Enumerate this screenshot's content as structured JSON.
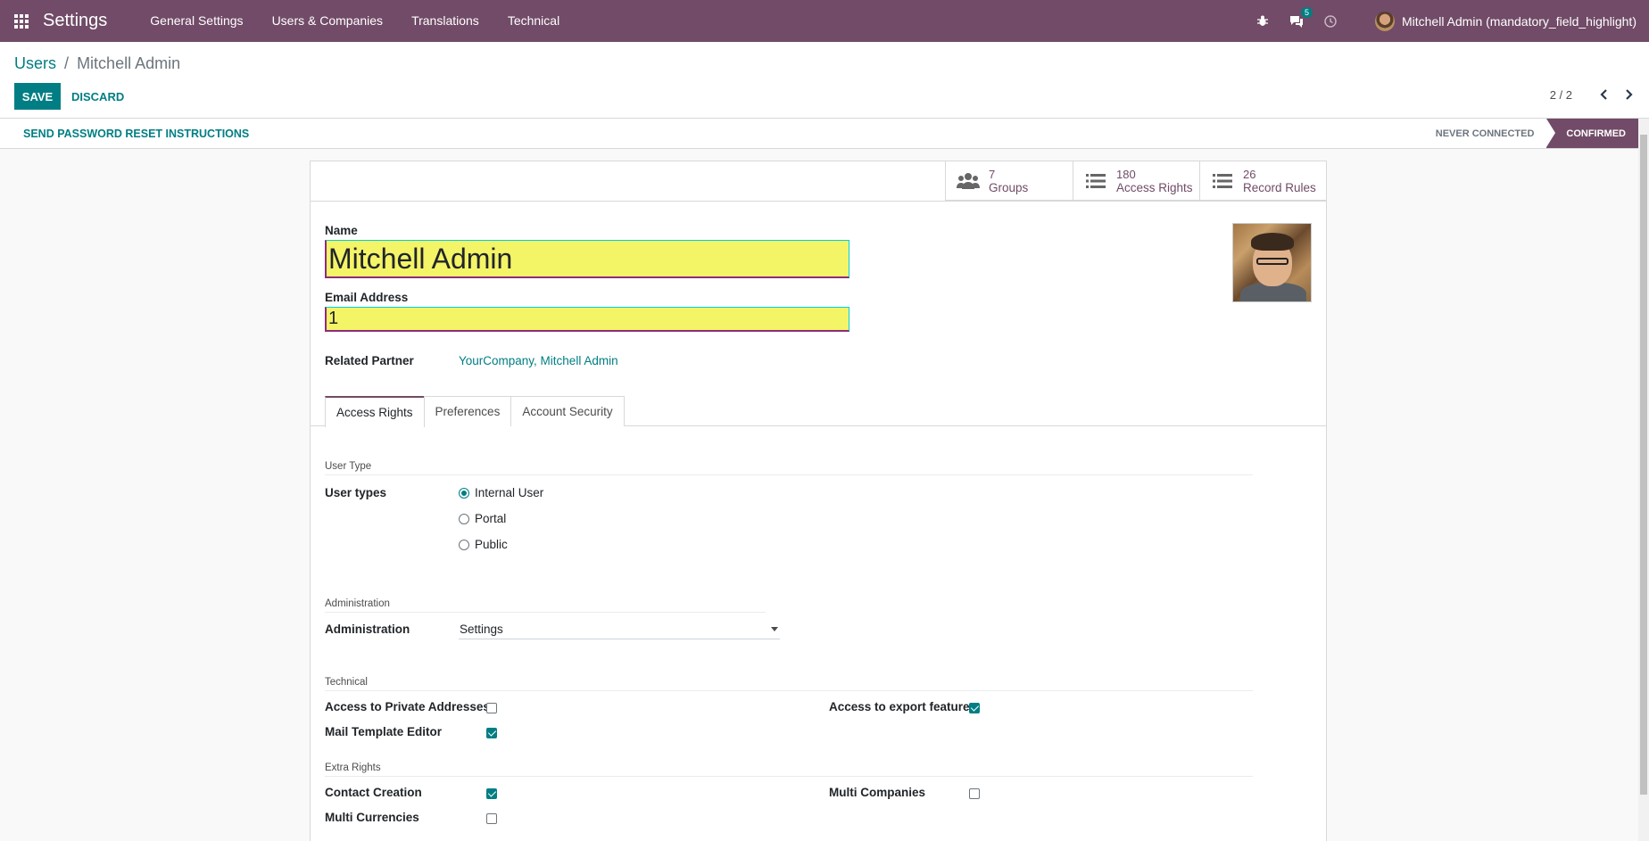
{
  "navbar": {
    "brand": "Settings",
    "menu": [
      "General Settings",
      "Users & Companies",
      "Translations",
      "Technical"
    ],
    "messages_count": "5",
    "user_name": "Mitchell Admin (mandatory_field_highlight)"
  },
  "breadcrumb": {
    "parent": "Users",
    "separator": "/",
    "current": "Mitchell Admin"
  },
  "buttons": {
    "save": "SAVE",
    "discard": "DISCARD"
  },
  "pager": {
    "value": "2 / 2"
  },
  "statusbar": {
    "reset_button": "SEND PASSWORD RESET INSTRUCTIONS",
    "steps": [
      "NEVER CONNECTED",
      "CONFIRMED"
    ],
    "active_step": "CONFIRMED"
  },
  "stat_buttons": [
    {
      "value": "7",
      "label": "Groups",
      "icon": "users-icon"
    },
    {
      "value": "180",
      "label": "Access Rights",
      "icon": "list-icon"
    },
    {
      "value": "26",
      "label": "Record Rules",
      "icon": "list-icon"
    }
  ],
  "form": {
    "name_label": "Name",
    "name_value": "Mitchell Admin",
    "email_label": "Email Address",
    "email_value": "1",
    "partner_label": "Related Partner",
    "partner_value": "YourCompany, Mitchell Admin"
  },
  "tabs": [
    "Access Rights",
    "Preferences",
    "Account Security"
  ],
  "access_rights": {
    "user_type_title": "User Type",
    "user_types_label": "User types",
    "user_types": [
      {
        "label": "Internal User",
        "selected": true
      },
      {
        "label": "Portal",
        "selected": false
      },
      {
        "label": "Public",
        "selected": false
      }
    ],
    "administration_title": "Administration",
    "administration_label": "Administration",
    "administration_value": "Settings",
    "technical_title": "Technical",
    "technical": [
      {
        "label": "Access to Private Addresses",
        "checked": false
      },
      {
        "label": "Access to export feature",
        "checked": true
      },
      {
        "label": "Mail Template Editor",
        "checked": true
      }
    ],
    "extra_title": "Extra Rights",
    "extra": [
      {
        "label": "Contact Creation",
        "checked": true
      },
      {
        "label": "Multi Companies",
        "checked": false
      },
      {
        "label": "Multi Currencies",
        "checked": false
      }
    ]
  },
  "colors": {
    "brand": "#714b67",
    "accent": "#017e84",
    "highlight": "#f4f467"
  }
}
